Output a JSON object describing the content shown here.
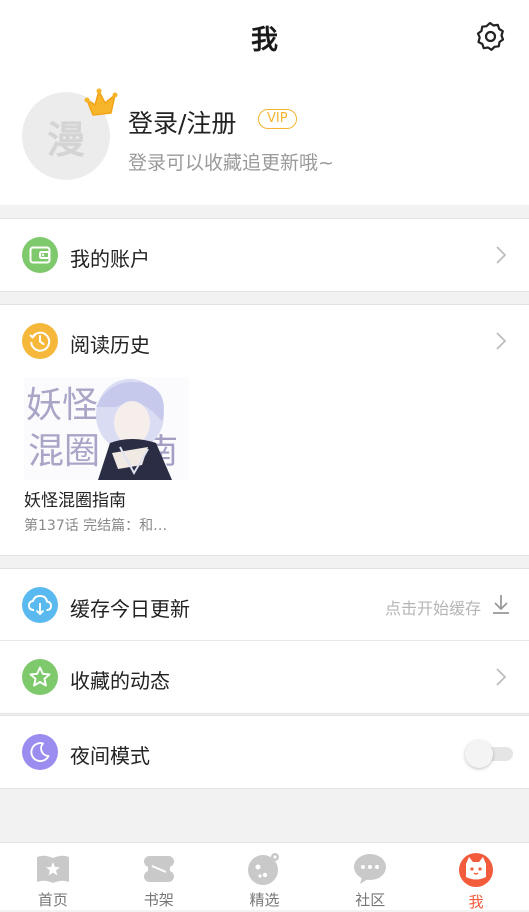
{
  "header": {
    "title": "我",
    "settings_icon": "gear-icon"
  },
  "profile": {
    "avatar_text": "漫",
    "login_title": "登录/注册",
    "vip_label": "VIP",
    "subtitle": "登录可以收藏追更新哦~",
    "crown_icon": "crown-icon"
  },
  "menu": {
    "account": {
      "label": "我的账户",
      "icon": "wallet-icon",
      "color": "#7dc96b"
    },
    "history": {
      "label": "阅读历史",
      "icon": "clock-icon",
      "color": "#f6b83b",
      "book": {
        "title": "妖怪混圈指南",
        "progress": "第137话 完结篇：和…",
        "cover_text": "妖怪混圈指南"
      }
    },
    "cache": {
      "label": "缓存今日更新",
      "hint": "点击开始缓存",
      "icon": "cloud-download-icon",
      "color": "#5ab9ef"
    },
    "favorites": {
      "label": "收藏的动态",
      "icon": "star-icon",
      "color": "#7dc96b"
    },
    "night": {
      "label": "夜间模式",
      "icon": "moon-icon",
      "color": "#9b8cf0",
      "enabled": false
    }
  },
  "tabs": [
    {
      "label": "首页",
      "icon": "home-star-icon"
    },
    {
      "label": "书架",
      "icon": "bookshelf-icon"
    },
    {
      "label": "精选",
      "icon": "featured-icon"
    },
    {
      "label": "社区",
      "icon": "chat-bubble-icon"
    },
    {
      "label": "我",
      "icon": "profile-cat-icon",
      "active": true
    }
  ],
  "colors": {
    "accent": "#f25c3c",
    "vip": "#f5b531"
  }
}
